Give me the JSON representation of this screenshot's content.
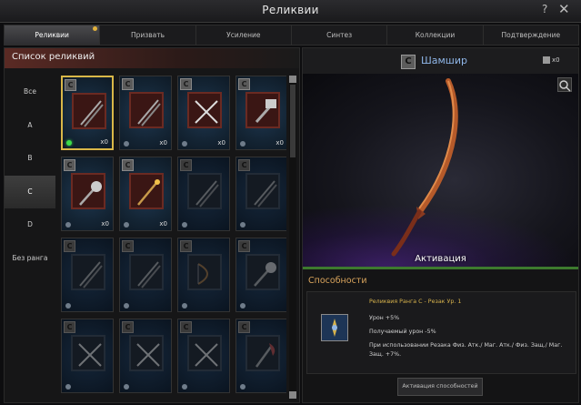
{
  "window": {
    "title": "Реликвии",
    "help": "?",
    "close": "✕"
  },
  "tabs": [
    {
      "label": "Реликвии",
      "active": true,
      "notice": true
    },
    {
      "label": "Призвать"
    },
    {
      "label": "Усиление"
    },
    {
      "label": "Синтез"
    },
    {
      "label": "Коллекции"
    },
    {
      "label": "Подтверждение"
    }
  ],
  "list": {
    "header": "Список реликвий",
    "ranks": [
      "Все",
      "A",
      "B",
      "C",
      "D",
      "Без ранга"
    ],
    "active_rank": "C"
  },
  "relics": [
    {
      "rank": "C",
      "count": "x0",
      "icon": "swords-icon",
      "orb": "green",
      "selected": true
    },
    {
      "rank": "C",
      "count": "x0",
      "icon": "swords-icon"
    },
    {
      "rank": "C",
      "count": "x0",
      "icon": "crossed-swords-icon"
    },
    {
      "rank": "C",
      "count": "x0",
      "icon": "hammer-icon"
    },
    {
      "rank": "C",
      "count": "x0",
      "icon": "mace-icon"
    },
    {
      "rank": "C",
      "count": "x0",
      "icon": "staff-icon"
    },
    {
      "rank": "C",
      "count": "",
      "icon": "swords-icon",
      "locked": true
    },
    {
      "rank": "C",
      "count": "",
      "icon": "swords-icon",
      "locked": true
    },
    {
      "rank": "C",
      "count": "",
      "icon": "swords-icon",
      "locked": true
    },
    {
      "rank": "C",
      "count": "",
      "icon": "swords-icon",
      "locked": true
    },
    {
      "rank": "C",
      "count": "",
      "icon": "bow-icon",
      "locked": true
    },
    {
      "rank": "C",
      "count": "",
      "icon": "mace-icon",
      "locked": true
    },
    {
      "rank": "C",
      "count": "",
      "icon": "crossed-swords-icon",
      "locked": true
    },
    {
      "rank": "C",
      "count": "",
      "icon": "crossed-swords-icon",
      "locked": true
    },
    {
      "rank": "C",
      "count": "",
      "icon": "crossed-swords-icon",
      "locked": true
    },
    {
      "rank": "C",
      "count": "",
      "icon": "axe-icon",
      "locked": true
    }
  ],
  "detail": {
    "rank": "C",
    "name": "Шамшир",
    "count": "x0",
    "activation_label": "Активация",
    "abilities_title": "Способности",
    "ability_name": "Реликвия Ранга C - Резак Ур. 1",
    "ability_lines": [
      "Урон +5%",
      "Получаемый урон -5%",
      "При использовании Резака Физ. Атк./ Маг. Атк./ Физ. Защ./ Маг.",
      "Защ. +7%."
    ],
    "activate_button": "Активация способностей"
  },
  "colors": {
    "accent": "#d9b748",
    "relic_name": "#8fb6e8",
    "ability_name": "#d6b24c",
    "activation_bar": "#3d7a2e"
  }
}
